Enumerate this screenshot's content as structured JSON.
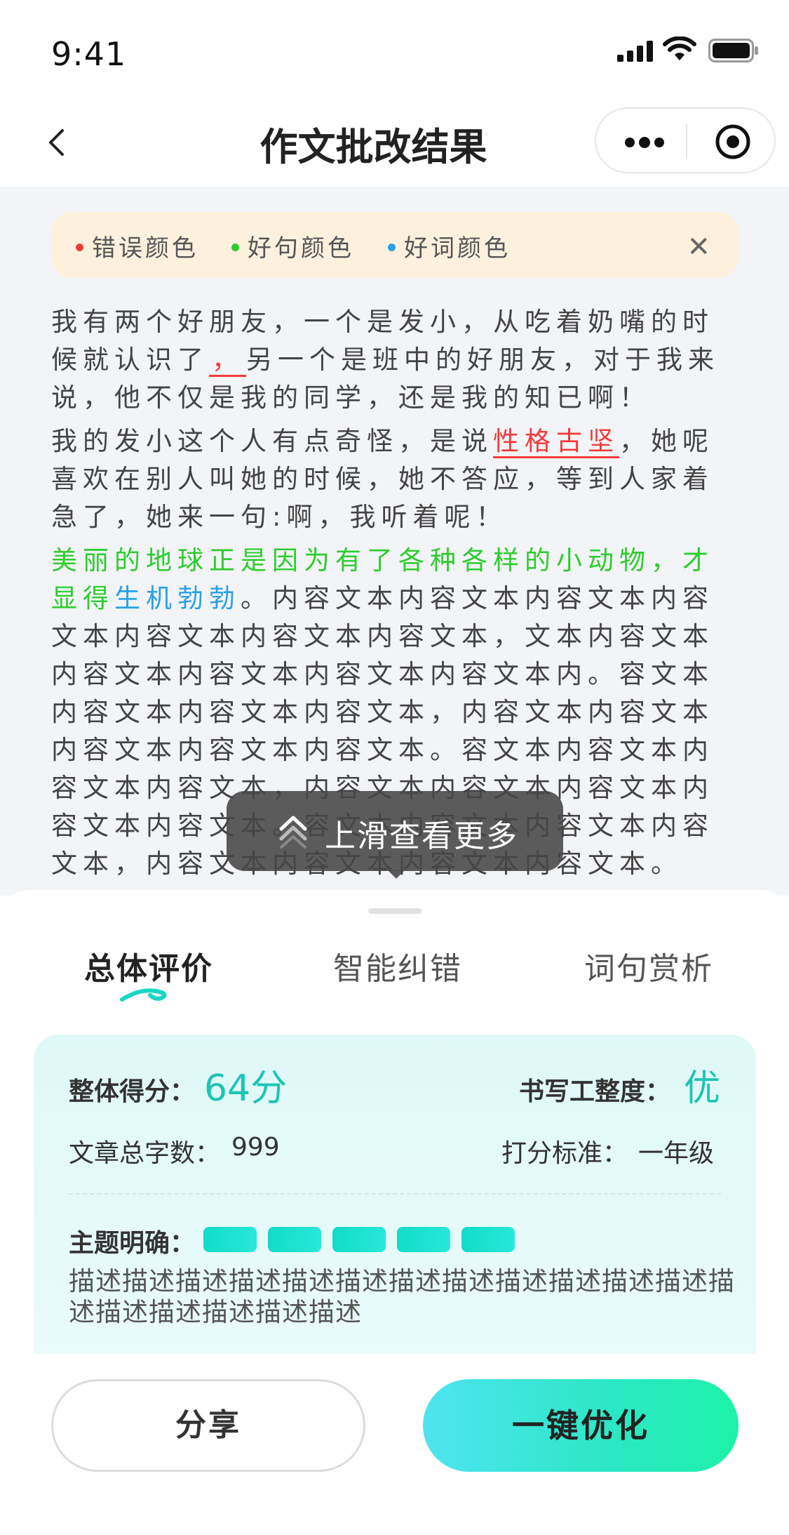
{
  "status_bar": {
    "time": "9:41"
  },
  "nav": {
    "title": "作文批改结果"
  },
  "legend": {
    "items": [
      {
        "label": "错误颜色",
        "color": "#f23b3b"
      },
      {
        "label": "好句颜色",
        "color": "#2ecc2e"
      },
      {
        "label": "好词颜色",
        "color": "#2aa0e6"
      }
    ]
  },
  "essay": {
    "p1_a": "我有两个好朋友，一个是发小，从吃着奶嘴的时候就认识了",
    "p1_err": "，",
    "p1_b": "另一个是班中的好朋友，对于我来说，他不仅是我的同学，还是我的知已啊！",
    "p2_a": "我的发小这个人有点奇怪，是说",
    "p2_err": "性格古坚",
    "p2_b": "，她呢喜欢在别人叫她的时候，她不答应，等到人家着急了，她来一句:啊，我听着呢！",
    "p3_good_sentence": "美丽的地球正是因为有了各种各样的小动物，才显得",
    "p3_good_word": "生机勃勃",
    "p3_rest": "。内容文本内容文本内容文本内容文本内容文本内容文本内容文本，文本内容文本内容文本内容文本内容文本内容文本内。容文本内容文本内容文本内容文本，内容文本内容文本内容文本内容文本内容文本。容文本内容文本内容文本内容文本，内容文本内容文本内容文本内容文本内容文本。容文本内容文本内容文本内容文本，内容文本内容文本内容文本内容文本。"
  },
  "toast": {
    "text": "上滑查看更多"
  },
  "tabs": [
    {
      "label": "总体评价",
      "active": true
    },
    {
      "label": "智能纠错",
      "active": false
    },
    {
      "label": "词句赏析",
      "active": false
    }
  ],
  "summary": {
    "score_label": "整体得分：",
    "score_value": "64分",
    "writing_label": "书写工整度：",
    "writing_value": "优",
    "word_count_label": "文章总字数：",
    "word_count_value": "999",
    "standard_label": "打分标准：",
    "standard_value": "一年级",
    "theme_label": "主题明确：",
    "theme_level": 5,
    "theme_max": 5,
    "description": "描述描述描述描述描述描述描述描述描述描述描述描述描述描述描述描述描述描述"
  },
  "buttons": {
    "share": "分享",
    "optimize": "一键优化"
  }
}
